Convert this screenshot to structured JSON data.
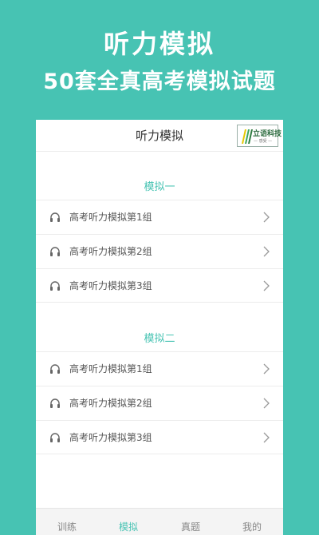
{
  "hero": {
    "title": "听力模拟",
    "subtitle": "50套全真高考模拟试题"
  },
  "topbar": {
    "title": "听力模拟",
    "logo_text": "立语科技",
    "logo_sub": "— 感受 —"
  },
  "sections": [
    {
      "title": "模拟一",
      "items": [
        {
          "label": "高考听力模拟第1组",
          "icon": "headphones-icon"
        },
        {
          "label": "高考听力模拟第2组",
          "icon": "headphones-icon"
        },
        {
          "label": "高考听力模拟第3组",
          "icon": "headphones-icon"
        }
      ]
    },
    {
      "title": "模拟二",
      "items": [
        {
          "label": "高考听力模拟第1组",
          "icon": "headphones-icon"
        },
        {
          "label": "高考听力模拟第2组",
          "icon": "headphones-icon"
        },
        {
          "label": "高考听力模拟第3组",
          "icon": "headphones-icon"
        }
      ]
    }
  ],
  "tabbar": {
    "tabs": [
      {
        "label": "训练"
      },
      {
        "label": "模拟"
      },
      {
        "label": "真题"
      },
      {
        "label": "我的"
      }
    ],
    "active_index": 1
  },
  "colors": {
    "accent": "#47c3b3",
    "background": "#47c3b3",
    "text": "#555555"
  }
}
